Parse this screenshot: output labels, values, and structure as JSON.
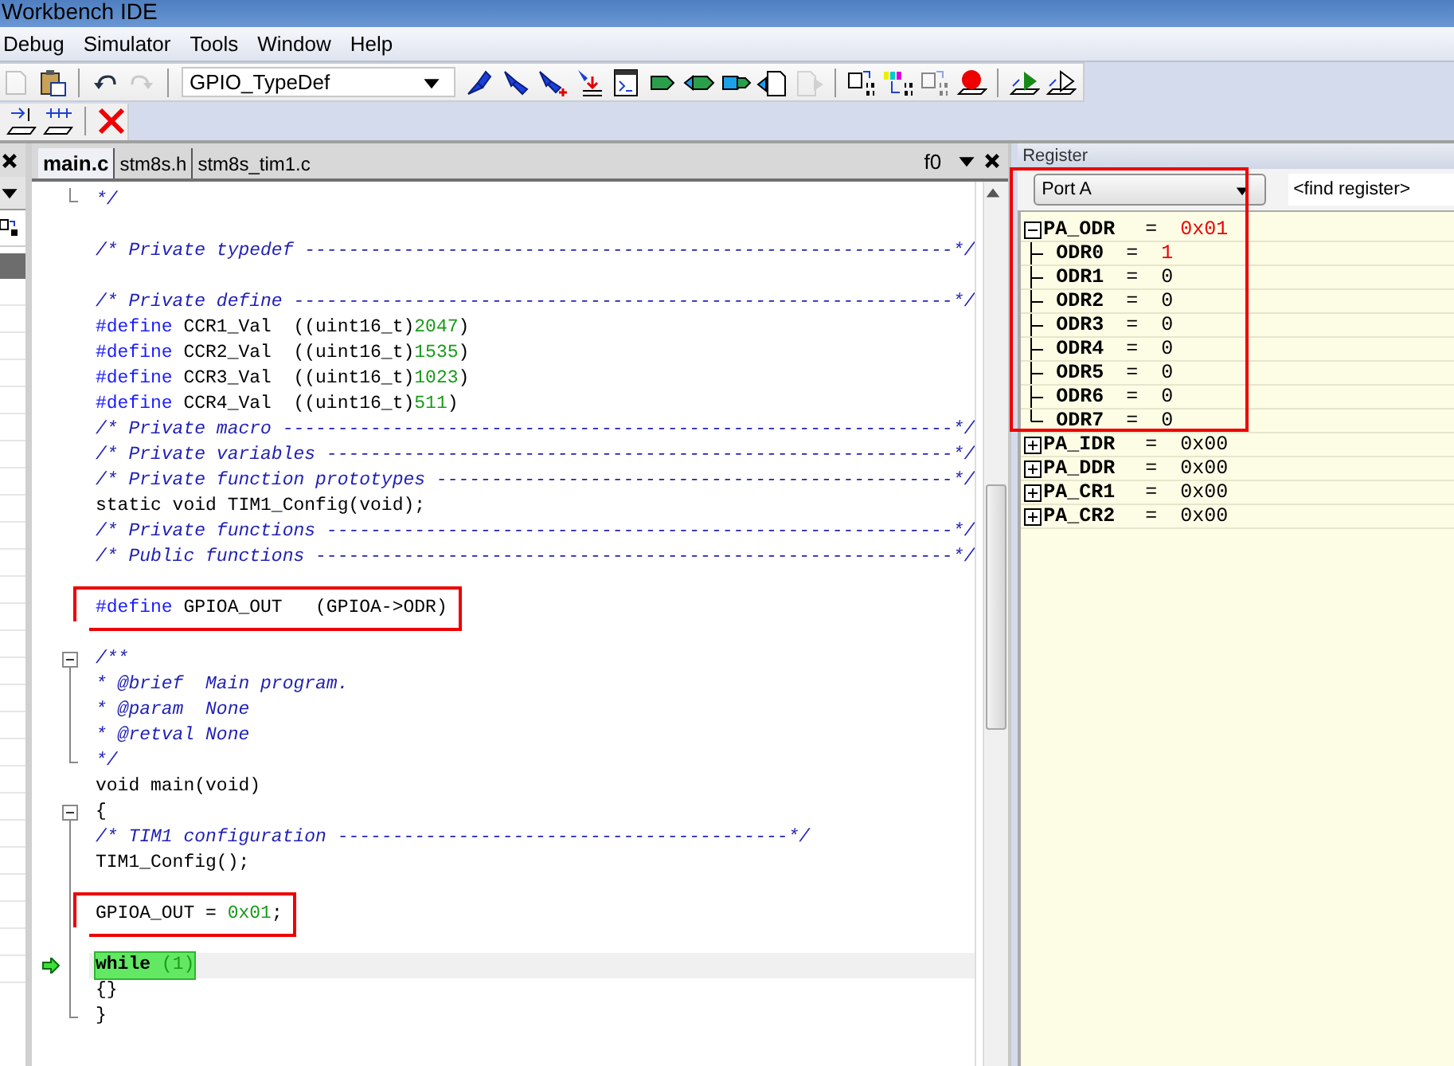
{
  "window": {
    "title": "Workbench IDE"
  },
  "menu": [
    "Debug",
    "Simulator",
    "Tools",
    "Window",
    "Help"
  ],
  "toolbar": {
    "icons_before": [
      {
        "kind": "document",
        "disabled": true
      },
      {
        "kind": "paste",
        "disabled": false
      },
      {
        "kind": "separator"
      },
      {
        "kind": "undo",
        "disabled": false
      },
      {
        "kind": "redo",
        "disabled": true
      },
      {
        "kind": "separator"
      }
    ],
    "combo": {
      "value": "GPIO_TypeDef"
    },
    "icons_after": [
      {
        "kind": "probe",
        "disabled": false
      },
      {
        "kind": "probe-down",
        "disabled": false
      },
      {
        "kind": "probe-add",
        "disabled": false
      },
      {
        "kind": "probe-bar",
        "disabled": false
      },
      {
        "kind": "window",
        "disabled": false
      },
      {
        "kind": "tag",
        "disabled": false
      },
      {
        "kind": "tag-left",
        "disabled": false
      },
      {
        "kind": "tag-right",
        "disabled": false
      },
      {
        "kind": "doc-left",
        "disabled": false
      },
      {
        "kind": "doc-right",
        "disabled": true
      },
      {
        "kind": "separator"
      },
      {
        "kind": "binary",
        "disabled": false
      },
      {
        "kind": "binary-multi",
        "disabled": false
      },
      {
        "kind": "binary",
        "disabled": true
      },
      {
        "kind": "breakpoint",
        "disabled": false
      },
      {
        "kind": "separator"
      },
      {
        "kind": "run",
        "disabled": false
      },
      {
        "kind": "run-outline",
        "disabled": false
      }
    ]
  },
  "debug_toolbar": {
    "icons": [
      {
        "kind": "step-in",
        "disabled": false
      },
      {
        "kind": "step-multi",
        "disabled": false
      },
      {
        "kind": "separator"
      },
      {
        "kind": "stop",
        "disabled": false
      }
    ]
  },
  "editor": {
    "tabs": [
      {
        "label": "main.c",
        "selected": true
      },
      {
        "label": "stm8s.h",
        "selected": false
      },
      {
        "label": "stm8s_tim1.c",
        "selected": false
      }
    ],
    "function_box": "f0",
    "lines": [
      {
        "kind": "fold-end",
        "indented": true,
        "tokens": [
          {
            "text": "*/",
            "kind": "comment"
          }
        ]
      },
      {
        "kind": "line"
      },
      {
        "kind": "line",
        "tokens": [
          {
            "text": "/* Private typedef -----------------------------------------------------------*/",
            "kind": "comment"
          }
        ]
      },
      {
        "kind": "line"
      },
      {
        "kind": "line",
        "tokens": [
          {
            "text": "/* Private define ------------------------------------------------------------*/",
            "kind": "comment"
          }
        ]
      },
      {
        "kind": "line",
        "tokens": [
          {
            "text": "#define",
            "kind": "directive"
          },
          {
            "text": " CCR1_Val  ((uint16_t)",
            "kind": "plain"
          },
          {
            "text": "2047",
            "kind": "number"
          },
          {
            "text": ")",
            "kind": "plain"
          }
        ]
      },
      {
        "kind": "line",
        "tokens": [
          {
            "text": "#define",
            "kind": "directive"
          },
          {
            "text": " CCR2_Val  ((uint16_t)",
            "kind": "plain"
          },
          {
            "text": "1535",
            "kind": "number"
          },
          {
            "text": ")",
            "kind": "plain"
          }
        ]
      },
      {
        "kind": "line",
        "tokens": [
          {
            "text": "#define",
            "kind": "directive"
          },
          {
            "text": " CCR3_Val  ((uint16_t)",
            "kind": "plain"
          },
          {
            "text": "1023",
            "kind": "number"
          },
          {
            "text": ")",
            "kind": "plain"
          }
        ]
      },
      {
        "kind": "line",
        "tokens": [
          {
            "text": "#define",
            "kind": "directive"
          },
          {
            "text": " CCR4_Val  ((uint16_t)",
            "kind": "plain"
          },
          {
            "text": "511",
            "kind": "number"
          },
          {
            "text": ")",
            "kind": "plain"
          }
        ]
      },
      {
        "kind": "line",
        "tokens": [
          {
            "text": "/* Private macro -------------------------------------------------------------*/",
            "kind": "comment"
          }
        ]
      },
      {
        "kind": "line",
        "tokens": [
          {
            "text": "/* Private variables ---------------------------------------------------------*/",
            "kind": "comment"
          }
        ]
      },
      {
        "kind": "line",
        "tokens": [
          {
            "text": "/* Private function prototypes -----------------------------------------------*/",
            "kind": "comment"
          }
        ]
      },
      {
        "kind": "line",
        "tokens": [
          {
            "text": "static void TIM1_Config(void);",
            "kind": "plain"
          }
        ]
      },
      {
        "kind": "line",
        "tokens": [
          {
            "text": "/* Private functions ---------------------------------------------------------*/",
            "kind": "comment"
          }
        ]
      },
      {
        "kind": "line",
        "tokens": [
          {
            "text": "/* Public functions ----------------------------------------------------------*/",
            "kind": "comment"
          }
        ]
      },
      {
        "kind": "line"
      },
      {
        "kind": "line",
        "boxed": true,
        "tokens": [
          {
            "text": "#define",
            "kind": "directive"
          },
          {
            "text": " GPIOA_OUT   (GPIOA->ODR)",
            "kind": "plain"
          }
        ]
      },
      {
        "kind": "line"
      },
      {
        "kind": "fold-start",
        "tokens": [
          {
            "text": "/**",
            "kind": "comment"
          }
        ]
      },
      {
        "kind": "fold-inside",
        "indented": true,
        "tokens": [
          {
            "text": "* @brief  Main program.",
            "kind": "comment"
          }
        ]
      },
      {
        "kind": "fold-inside",
        "indented": true,
        "tokens": [
          {
            "text": "* @param  None",
            "kind": "comment"
          }
        ]
      },
      {
        "kind": "fold-inside",
        "indented": true,
        "tokens": [
          {
            "text": "* @retval None",
            "kind": "comment"
          }
        ]
      },
      {
        "kind": "fold-end",
        "indented": true,
        "tokens": [
          {
            "text": "*/",
            "kind": "comment"
          }
        ]
      },
      {
        "kind": "line",
        "tokens": [
          {
            "text": "void main(void)",
            "kind": "plain"
          }
        ]
      },
      {
        "kind": "fold-start",
        "tokens": [
          {
            "text": "{",
            "kind": "plain"
          }
        ]
      },
      {
        "kind": "fold-inside",
        "indented": true,
        "tokens": [
          {
            "text": "/* TIM1 configuration -----------------------------------------*/",
            "kind": "comment"
          }
        ]
      },
      {
        "kind": "fold-inside",
        "indented": true,
        "tokens": [
          {
            "text": "TIM1_Config();",
            "kind": "plain"
          }
        ]
      },
      {
        "kind": "fold-inside"
      },
      {
        "kind": "fold-inside",
        "indented": true,
        "boxed": true,
        "tokens": [
          {
            "text": "GPIOA_OUT = ",
            "kind": "plain"
          },
          {
            "text": "0x01",
            "kind": "number"
          },
          {
            "text": ";",
            "kind": "plain"
          }
        ]
      },
      {
        "kind": "fold-inside"
      },
      {
        "kind": "fold-inside",
        "indented": true,
        "current": true,
        "tokens": [
          {
            "text": "while",
            "kind": "keyword"
          },
          {
            "text": " (1)",
            "kind": "number"
          }
        ]
      },
      {
        "kind": "fold-inside",
        "indented": true,
        "tokens": [
          {
            "text": "{}",
            "kind": "plain"
          }
        ]
      },
      {
        "kind": "fold-end",
        "tokens": [
          {
            "text": "}",
            "kind": "plain"
          }
        ]
      }
    ]
  },
  "register_panel": {
    "title": "Register",
    "port": "Port A",
    "find_placeholder": "<find register>",
    "boxed": true,
    "registers": [
      {
        "name": "PA_ODR",
        "eq": "=",
        "value": "0x01",
        "changed": true,
        "expanded": true,
        "children": [
          {
            "name": "ODR0",
            "eq": "=",
            "value": "1",
            "changed": true
          },
          {
            "name": "ODR1",
            "eq": "=",
            "value": "0",
            "changed": false
          },
          {
            "name": "ODR2",
            "eq": "=",
            "value": "0",
            "changed": false
          },
          {
            "name": "ODR3",
            "eq": "=",
            "value": "0",
            "changed": false
          },
          {
            "name": "ODR4",
            "eq": "=",
            "value": "0",
            "changed": false
          },
          {
            "name": "ODR5",
            "eq": "=",
            "value": "0",
            "changed": false
          },
          {
            "name": "ODR6",
            "eq": "=",
            "value": "0",
            "changed": false
          },
          {
            "name": "ODR7",
            "eq": "=",
            "value": "0",
            "changed": false
          }
        ]
      },
      {
        "name": "PA_IDR",
        "eq": "=",
        "value": "0x00",
        "changed": false,
        "expanded": false
      },
      {
        "name": "PA_DDR",
        "eq": "=",
        "value": "0x00",
        "changed": false,
        "expanded": false
      },
      {
        "name": "PA_CR1",
        "eq": "=",
        "value": "0x00",
        "changed": false,
        "expanded": false
      },
      {
        "name": "PA_CR2",
        "eq": "=",
        "value": "0x00",
        "changed": false,
        "expanded": false
      }
    ]
  }
}
